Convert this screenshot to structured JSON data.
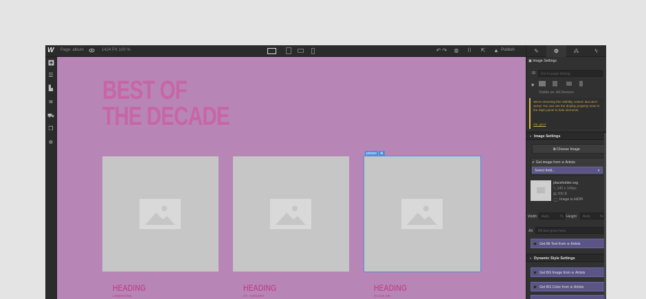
{
  "topbar": {
    "logo": "W",
    "page_label": "Page: album",
    "dimensions": "1424 PX 100 %",
    "publish": "Publish"
  },
  "canvas": {
    "hero_line1": "BEST OF",
    "hero_line2": "THE DECADE",
    "selection_tag": "picture",
    "cards": [
      {
        "heading": "HEADING",
        "sub": "LEMONADE"
      },
      {
        "heading": "HEADING",
        "sub": "ST. VINCENT"
      },
      {
        "heading": "HEADING",
        "sub": "IN COLOR"
      }
    ]
  },
  "panel": {
    "header": "Image Settings",
    "id_label": "ID",
    "id_placeholder": "For in-page linking",
    "visible_on": "Visible on:",
    "visible_value": "All Devices",
    "warning": "We're removing this visibility control. But don't worry! You can use the display property none in the Style panel to hide elements.",
    "warning_ok": "Ok, got it",
    "image_section": "Image Settings",
    "choose_image": "Choose Image",
    "get_image_from": "Get image from",
    "source": "Artists",
    "select_field": "Select field...",
    "file_name": "placeholder.svg",
    "file_dims": "140 x 140px",
    "file_size": "300 B",
    "hidpi": "Image is HiDPI",
    "width_label": "Width",
    "width_value": "Auto",
    "height_label": "Height",
    "height_value": "Auto",
    "alt_label": "Alt",
    "alt_placeholder": "Alt text goes here",
    "get_alt": "Get Alt Text from",
    "alt_source": "Artists",
    "dynamic_section": "Dynamic Style Settings",
    "get_bg_image": "Get BG Image from",
    "bg_image_source": "Artists",
    "get_bg_color": "Get BG Color from",
    "bg_color_source": "Artists"
  }
}
